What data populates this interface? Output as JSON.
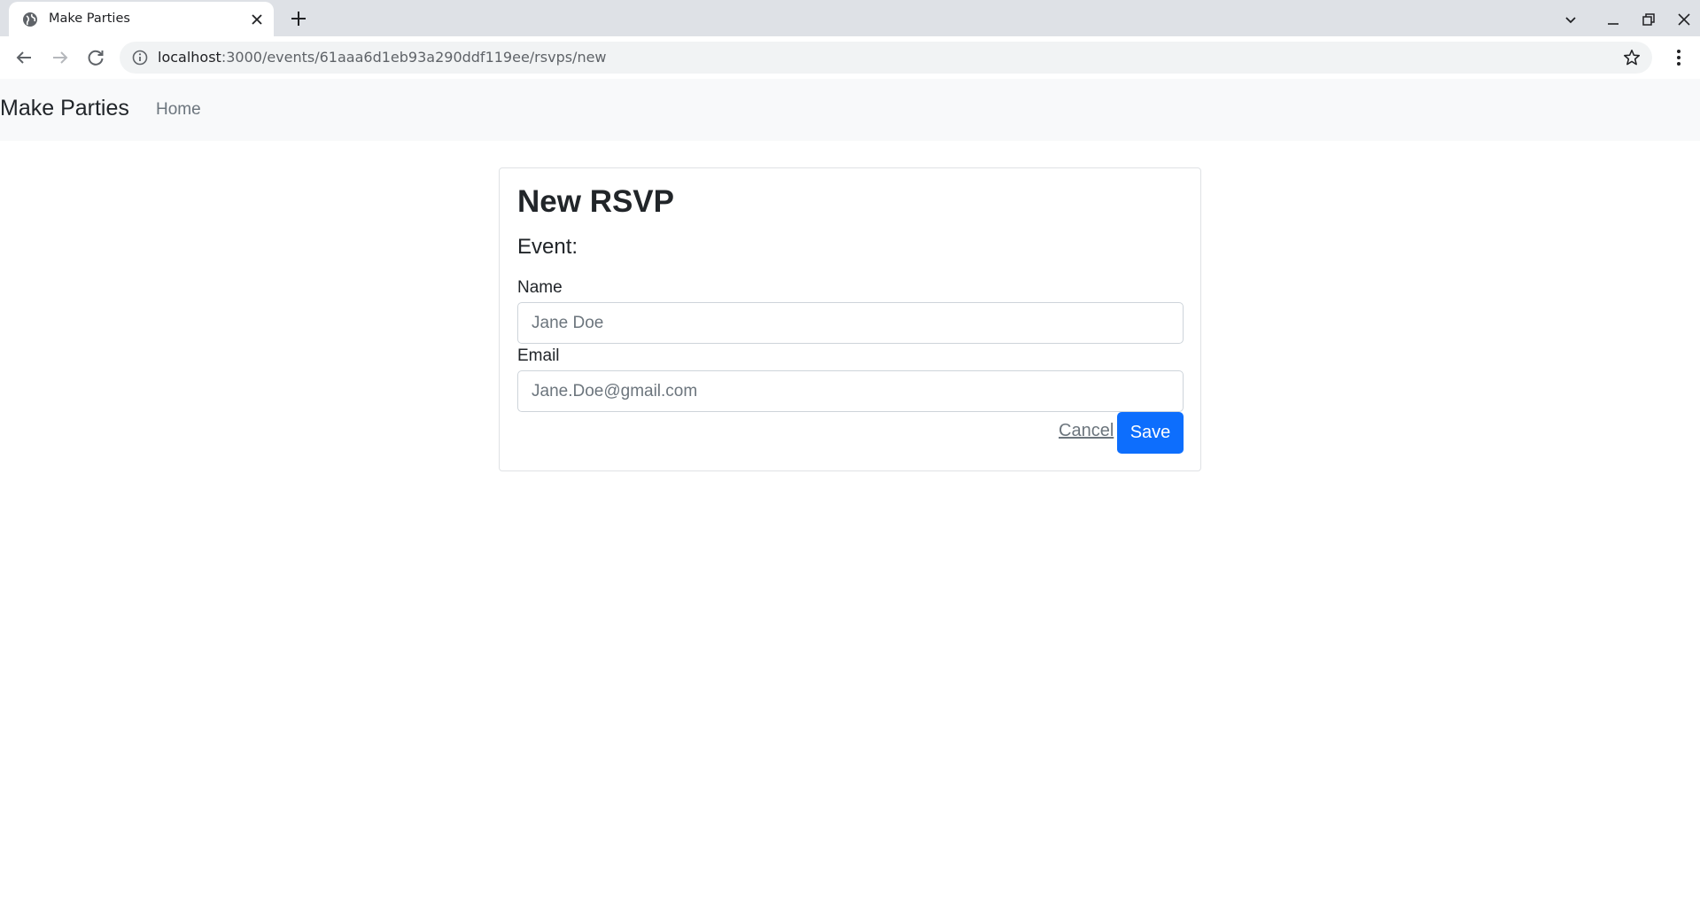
{
  "browser": {
    "tab_title": "Make Parties",
    "url_host": "localhost",
    "url_path": ":3000/events/61aaa6d1eb93a290ddf119ee/rsvps/new"
  },
  "navbar": {
    "brand": "Make Parties",
    "home_link": "Home"
  },
  "form": {
    "title": "New RSVP",
    "event_label": "Event:",
    "name_label": "Name",
    "name_placeholder": "Jane Doe",
    "email_label": "Email",
    "email_placeholder": "Jane.Doe@gmail.com",
    "cancel_label": "Cancel",
    "save_label": "Save"
  },
  "colors": {
    "primary": "#0d6efd",
    "navbar_bg": "#f8f9fa",
    "tabstrip_bg": "#dee1e6"
  }
}
